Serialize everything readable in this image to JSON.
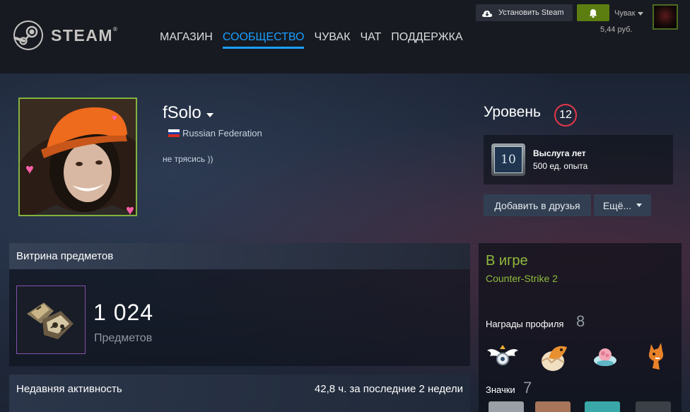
{
  "header": {
    "logo_text": "STEAM",
    "nav": [
      "МАГАЗИН",
      "СООБЩЕСТВО",
      "ЧУВАК",
      "ЧАТ",
      "ПОДДЕРЖКА"
    ],
    "active_nav": "СООБЩЕСТВО",
    "install_label": "Установить Steam",
    "account_name": "Чувак",
    "wallet": "5,44 руб.",
    "icons": [
      "steam-logo-icon",
      "download-icon",
      "bell-icon",
      "chevron-down-icon"
    ],
    "colors": {
      "nav_active": "#1a9fff",
      "notify": "#5c7e10"
    }
  },
  "profile": {
    "persona_name": "fSolo",
    "country": "Russian Federation",
    "summary": "не трясись ))",
    "level_label": "Уровень",
    "level": "12",
    "badge_years": "10",
    "badge_name": "Выслуга лет",
    "badge_xp": "500 ед. опыта",
    "add_friend": "Добавить в друзья",
    "more": "Ещё..."
  },
  "showcase": {
    "title": "Витрина предметов",
    "count": "1 024",
    "count_label": "Предметов"
  },
  "activity": {
    "title": "Недавняя активность",
    "hours": "42,8 ч. за последние 2 недели"
  },
  "sidebar": {
    "status": "В игре",
    "game": "Counter-Strike 2",
    "awards_label": "Награды профиля",
    "awards_count": "8",
    "badges_label": "Значки",
    "badges_count": "7",
    "status_color": "#90ba3c"
  }
}
